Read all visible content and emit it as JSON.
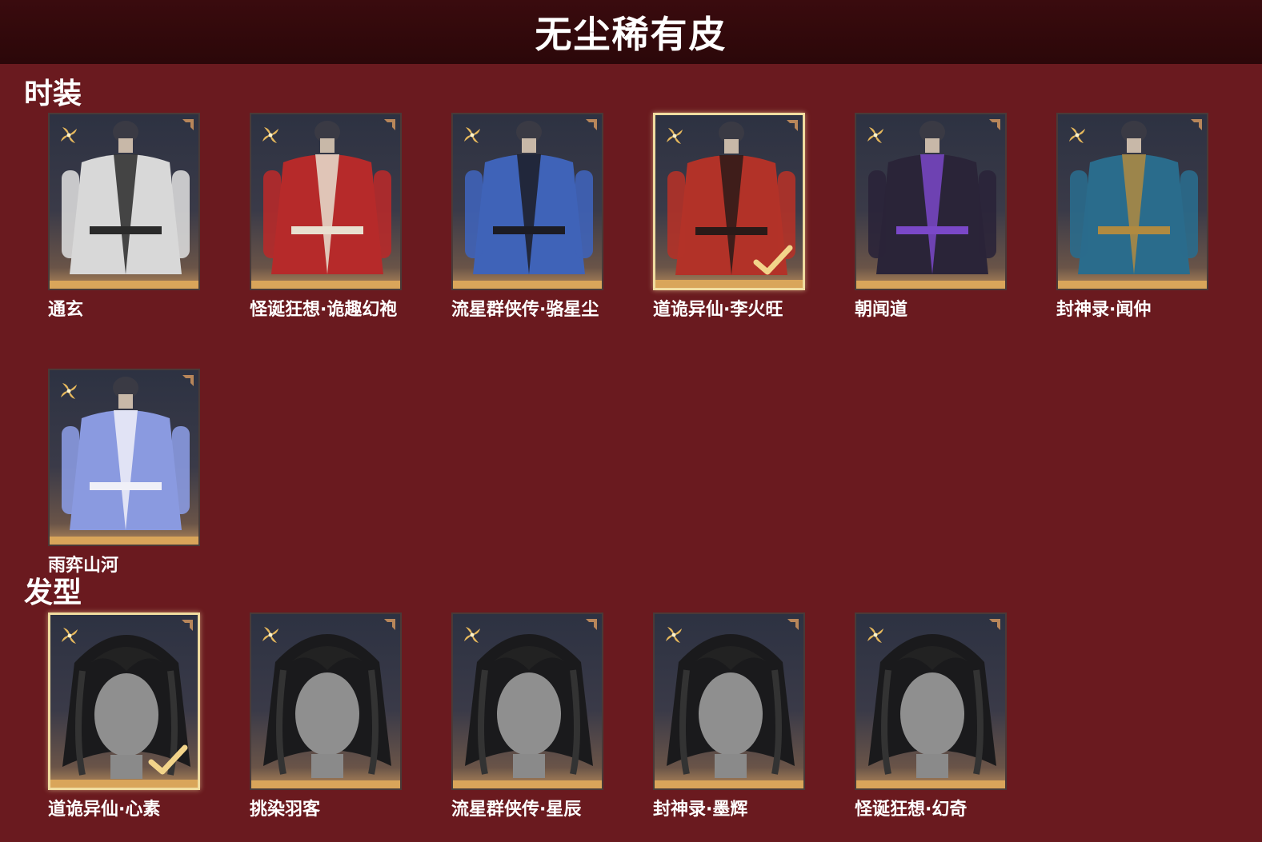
{
  "header": {
    "title": "无尘稀有皮"
  },
  "sections": {
    "fashion": {
      "title": "时装",
      "items": [
        {
          "name": "通玄",
          "selected": false
        },
        {
          "name": "怪诞狂想·诡趣幻袍",
          "selected": false
        },
        {
          "name": "流星群侠传·骆星尘",
          "selected": false
        },
        {
          "name": "道诡异仙·李火旺",
          "selected": true
        },
        {
          "name": "朝闻道",
          "selected": false
        },
        {
          "name": "封神录·闻仲",
          "selected": false
        },
        {
          "name": "雨弈山河",
          "selected": false
        }
      ]
    },
    "hair": {
      "title": "发型",
      "items": [
        {
          "name": "道诡异仙·心素",
          "selected": true
        },
        {
          "name": "挑染羽客",
          "selected": false
        },
        {
          "name": "流星群侠传·星辰",
          "selected": false
        },
        {
          "name": "封神录·墨辉",
          "selected": false
        },
        {
          "name": "怪诞狂想·幻奇",
          "selected": false
        }
      ]
    }
  },
  "colors": {
    "background": "#6a1a1f",
    "header": "#2b0709",
    "rarity_gold": "#d9a55a",
    "selected_border": "#f0dca0"
  },
  "icons": {
    "rarity": "gold-flower-icon",
    "corner": "corner-ornament-icon",
    "equipped": "checkmark-icon"
  }
}
